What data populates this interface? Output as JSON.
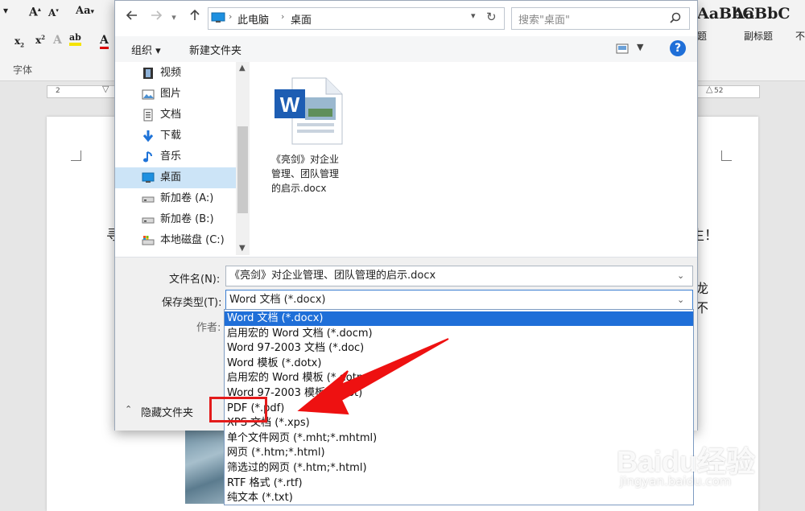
{
  "ribbon": {
    "font_group_label": "字体",
    "style_preview_1": "AaBbC",
    "style_preview_1_name": "题",
    "style_preview_2": "AaBbC",
    "style_preview_2_name": "副标题",
    "style_preview_3_name": "不"
  },
  "ruler": {
    "left_mark": "2",
    "right_mark": "52"
  },
  "document": {
    "fragment_1": "寻",
    "fragment_2": "生！",
    "fragment_3": "龙",
    "fragment_4": "不"
  },
  "dialog": {
    "breadcrumb": [
      "此电脑",
      "桌面"
    ],
    "search_placeholder": "搜索\"桌面\"",
    "toolbar": {
      "organize": "组织 ▾",
      "new_folder": "新建文件夹"
    },
    "nav_items": [
      {
        "label": "视频",
        "icon": "video-icon"
      },
      {
        "label": "图片",
        "icon": "picture-icon"
      },
      {
        "label": "文档",
        "icon": "document-icon"
      },
      {
        "label": "下载",
        "icon": "download-icon"
      },
      {
        "label": "音乐",
        "icon": "music-icon"
      },
      {
        "label": "桌面",
        "icon": "desktop-icon",
        "selected": true
      },
      {
        "label": "新加卷 (A:)",
        "icon": "drive-icon"
      },
      {
        "label": "新加卷 (B:)",
        "icon": "drive-icon"
      },
      {
        "label": "本地磁盘 (C:)",
        "icon": "system-drive-icon"
      }
    ],
    "file": {
      "name_line1": "《亮剑》对企业",
      "name_line2": "管理、团队管理",
      "name_line3": "的启示.docx"
    },
    "filename_label": "文件名(N):",
    "filename_value": "《亮剑》对企业管理、团队管理的启示.docx",
    "savetype_label": "保存类型(T):",
    "savetype_value": "Word 文档 (*.docx)",
    "author_label": "作者:",
    "hide_folders": "隐藏文件夹"
  },
  "savetype_options": [
    "Word 文档 (*.docx)",
    "启用宏的 Word 文档 (*.docm)",
    "Word 97-2003 文档 (*.doc)",
    "Word 模板 (*.dotx)",
    "启用宏的 Word 模板 (*.dotm)",
    "Word 97-2003 模板 (*.dot)",
    "PDF (*.pdf)",
    "XPS 文档 (*.xps)",
    "单个文件网页 (*.mht;*.mhtml)",
    "网页 (*.htm;*.html)",
    "筛选过的网页 (*.htm;*.html)",
    "RTF 格式 (*.rtf)",
    "纯文本 (*.txt)"
  ],
  "watermark": {
    "brand": "Baidu经验",
    "url": "jingyan.baidu.com"
  },
  "colors": {
    "selection": "#1f6fd8",
    "annotation": "#e31b1b",
    "help": "#1f6fd8"
  }
}
